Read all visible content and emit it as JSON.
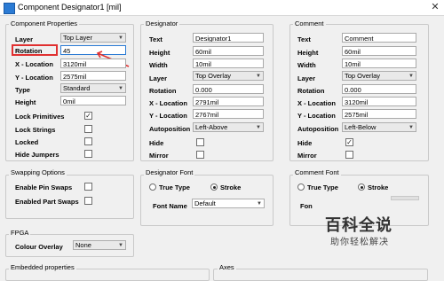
{
  "window": {
    "title": "Component Designator1 [mil]"
  },
  "component_properties": {
    "legend": "Component Properties",
    "layer": {
      "label": "Layer",
      "value": "Top Layer"
    },
    "rotation": {
      "label": "Rotation",
      "value": "45"
    },
    "x_location": {
      "label": "X - Location",
      "value": "3120mil"
    },
    "y_location": {
      "label": "Y - Location",
      "value": "2575mil"
    },
    "type": {
      "label": "Type",
      "value": "Standard"
    },
    "height": {
      "label": "Height",
      "value": "0mil"
    },
    "lock_primitives": {
      "label": "Lock Primitives",
      "checked": true
    },
    "lock_strings": {
      "label": "Lock Strings",
      "checked": false
    },
    "locked": {
      "label": "Locked",
      "checked": false
    },
    "hide_jumpers": {
      "label": "Hide Jumpers",
      "checked": false
    }
  },
  "designator": {
    "legend": "Designator",
    "text": {
      "label": "Text",
      "value": "Designator1"
    },
    "height": {
      "label": "Height",
      "value": "60mil"
    },
    "width": {
      "label": "Width",
      "value": "10mil"
    },
    "layer": {
      "label": "Layer",
      "value": "Top Overlay"
    },
    "rotation": {
      "label": "Rotation",
      "value": "0.000"
    },
    "x_location": {
      "label": "X - Location",
      "value": "2791mil"
    },
    "y_location": {
      "label": "Y - Location",
      "value": "2767mil"
    },
    "autoposition": {
      "label": "Autoposition",
      "value": "Left-Above"
    },
    "hide": {
      "label": "Hide",
      "checked": false
    },
    "mirror": {
      "label": "Mirror",
      "checked": false
    }
  },
  "comment": {
    "legend": "Comment",
    "text": {
      "label": "Text",
      "value": "Comment"
    },
    "height": {
      "label": "Height",
      "value": "60mil"
    },
    "width": {
      "label": "Width",
      "value": "10mil"
    },
    "layer": {
      "label": "Layer",
      "value": "Top Overlay"
    },
    "rotation": {
      "label": "Rotation",
      "value": "0.000"
    },
    "x_location": {
      "label": "X - Location",
      "value": "3120mil"
    },
    "y_location": {
      "label": "Y - Location",
      "value": "2575mil"
    },
    "autoposition": {
      "label": "Autoposition",
      "value": "Left-Below"
    },
    "hide": {
      "label": "Hide",
      "checked": true
    },
    "mirror": {
      "label": "Mirror",
      "checked": false
    }
  },
  "swapping_options": {
    "legend": "Swapping Options",
    "enable_pin_swaps": {
      "label": "Enable Pin Swaps",
      "checked": false
    },
    "enable_part_swaps": {
      "label": "Enabled Part Swaps",
      "checked": false
    }
  },
  "designator_font": {
    "legend": "Designator Font",
    "true_type": {
      "label": "True Type",
      "selected": false
    },
    "stroke": {
      "label": "Stroke",
      "selected": true
    },
    "font_name": {
      "label": "Font Name",
      "value": "Default"
    }
  },
  "comment_font": {
    "legend": "Comment Font",
    "true_type": {
      "label": "True Type",
      "selected": false
    },
    "stroke": {
      "label": "Stroke",
      "selected": true
    },
    "font_label": "Fon"
  },
  "fpga": {
    "legend": "FPGA",
    "colour_overlay": {
      "label": "Colour Overlay",
      "value": "None"
    }
  },
  "embedded_properties": {
    "legend": "Embedded properties"
  },
  "axes": {
    "legend": "Axes"
  },
  "watermark": {
    "title": "百科全说",
    "subtitle": "助你轻松解决"
  },
  "colors": {
    "highlight": "#e03030",
    "background": "#f0f0f0"
  }
}
